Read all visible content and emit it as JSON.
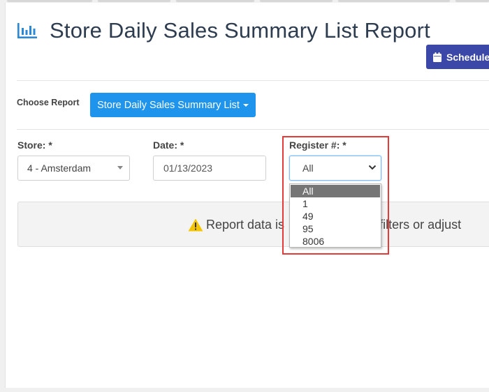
{
  "header": {
    "title": "Store Daily Sales Summary List Report",
    "schedule_label": "Schedule"
  },
  "report": {
    "choose_label": "Choose Report",
    "selected": "Store Daily Sales Summary List"
  },
  "filters": {
    "store": {
      "label": "Store: *",
      "value": "4 - Amsterdam"
    },
    "date": {
      "label": "Date: *",
      "value": "01/13/2023"
    },
    "register": {
      "label": "Register #: *",
      "value": "All",
      "options": [
        "All",
        "1",
        "49",
        "95",
        "8006"
      ],
      "selected_index": 0
    }
  },
  "alert": {
    "text_visible_left": "Report data is",
    "text_visible_right": "ng filters or adjust"
  },
  "colors": {
    "primary": "#1e94ec",
    "schedule": "#3c48a8",
    "title": "#2e3c50",
    "warning": "#f5c400",
    "highlight": "#e53a3a"
  },
  "icons": {
    "title": "bar-chart-icon",
    "schedule": "calendar-icon",
    "alert": "warning-icon"
  }
}
